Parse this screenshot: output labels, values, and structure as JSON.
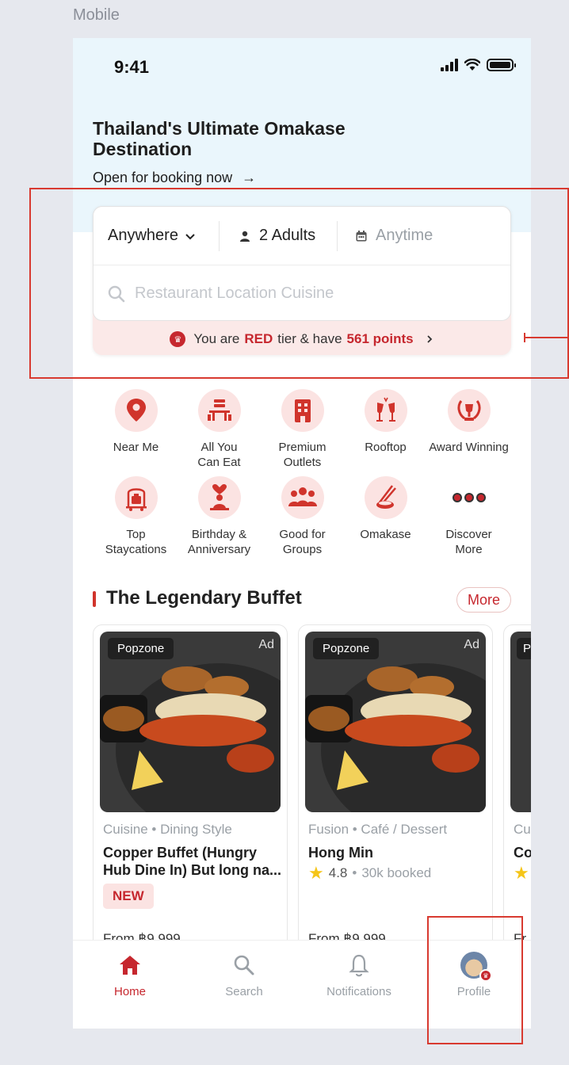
{
  "frame_label": "Mobile",
  "status": {
    "time": "9:41"
  },
  "hero": {
    "title": "Thailand's Ultimate Omakase Destination",
    "subtitle": "Open for booking now",
    "subtitle_arrow": "→"
  },
  "search": {
    "location": "Anywhere",
    "guests": "2 Adults",
    "date": "Anytime",
    "placeholder": "Restaurant Location Cuisine"
  },
  "tier": {
    "prefix": "You are",
    "tier_name": "RED",
    "middle": "tier & have",
    "points": "561 points"
  },
  "categories": [
    {
      "label": "Near Me",
      "icon": "location-pin-icon"
    },
    {
      "label": "All You Can Eat",
      "icon": "buffet-table-icon"
    },
    {
      "label": "Premium Outlets",
      "icon": "hotel-building-icon"
    },
    {
      "label": "Rooftop",
      "icon": "wine-glasses-icon"
    },
    {
      "label": "Award Winning",
      "icon": "laurel-trophy-icon"
    },
    {
      "label": "Top Staycations",
      "icon": "luggage-cart-icon"
    },
    {
      "label": "Birthday & Anniversary",
      "icon": "gift-heart-icon"
    },
    {
      "label": "Good for Groups",
      "icon": "group-people-icon"
    },
    {
      "label": "Omakase",
      "icon": "sushi-chopsticks-icon"
    },
    {
      "label": "Discover More",
      "icon": "more-dots-icon"
    }
  ],
  "section": {
    "title": "The Legendary Buffet",
    "more": "More"
  },
  "cards": [
    {
      "tag": "Popzone",
      "ad": "Ad",
      "meta": "Cuisine • Dining Style",
      "name": "Copper Buffet (Hungry Hub Dine In) But long na...",
      "badge": "NEW",
      "price": "From ฿9,999"
    },
    {
      "tag": "Popzone",
      "ad": "Ad",
      "meta": "Fusion • Café / Dessert",
      "name": "Hong Min",
      "rating": "4.8",
      "booked": "30k booked",
      "price": "From ฿9,999"
    },
    {
      "tag": "P",
      "meta": "Cu",
      "name": "Co Hu",
      "price": "Fr"
    }
  ],
  "tabs": [
    {
      "label": "Home"
    },
    {
      "label": "Search"
    },
    {
      "label": "Notifications"
    },
    {
      "label": "Profile"
    }
  ],
  "colors": {
    "brand": "#c6272e",
    "hero_bg": "#eaf6fc",
    "highlight": "#d83a30"
  }
}
